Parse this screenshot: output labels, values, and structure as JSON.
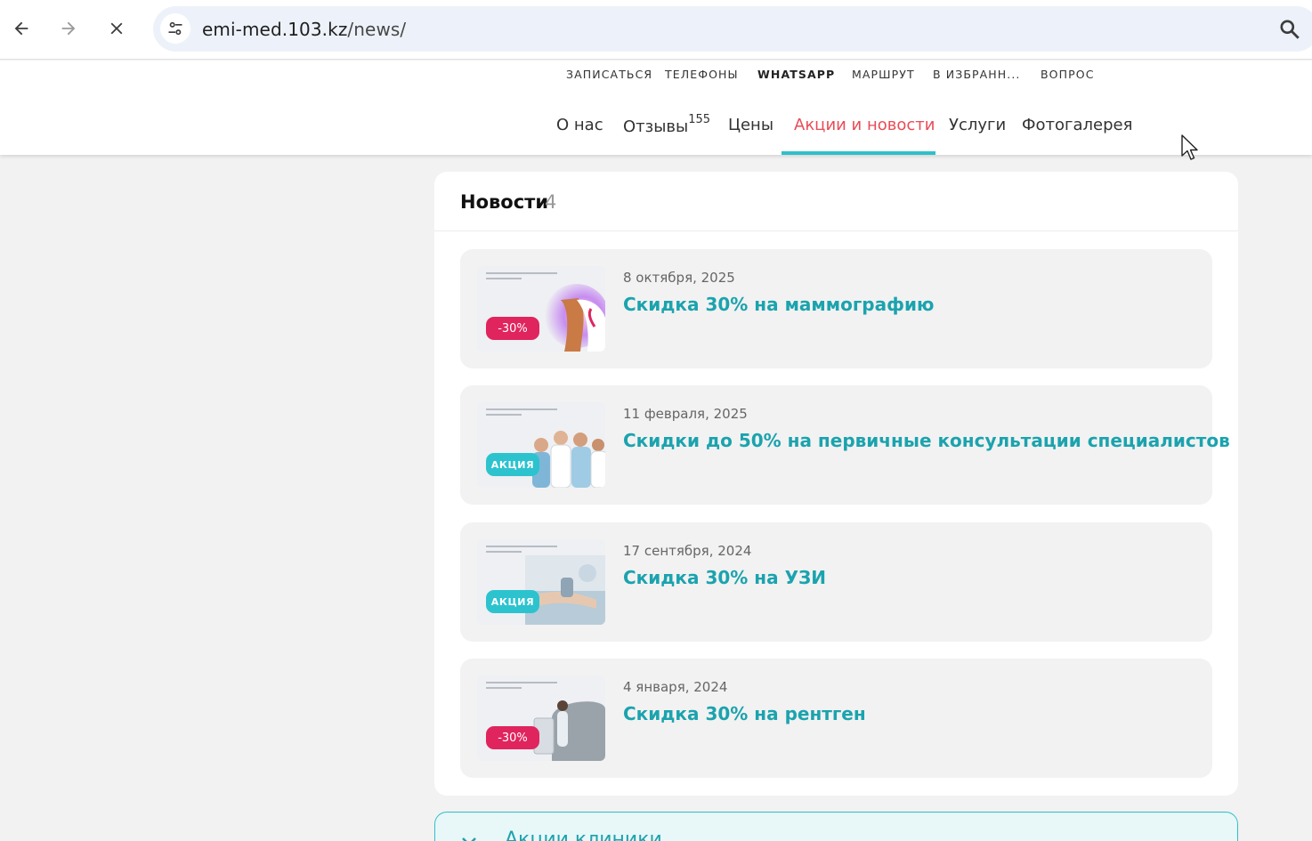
{
  "browser": {
    "url_host": "emi-med.103.kz",
    "url_path": "/news/",
    "back_icon": "arrow-left-icon",
    "forward_icon": "arrow-right-icon",
    "stop_icon": "close-icon",
    "site_info_icon": "tune-icon",
    "zoom_icon": "magnifier-icon"
  },
  "header": {
    "quick_links": [
      "ЗАПИСАТЬСЯ",
      "ТЕЛЕФОНЫ",
      "WHATSAPP",
      "МАРШРУТ",
      "В ИЗБРАНН...",
      "ВОПРОС"
    ],
    "tabs": [
      {
        "label": "О нас"
      },
      {
        "label": "Отзывы",
        "count": "155"
      },
      {
        "label": "Цены"
      },
      {
        "label": "Акции и новости"
      },
      {
        "label": "Услуги"
      },
      {
        "label": "Фотогалерея"
      }
    ],
    "active_color": "#e84c57",
    "underline_color": "#2fbfc9"
  },
  "news": {
    "title": "Новости",
    "count": "4",
    "items": [
      {
        "date": "8 октября, 2025",
        "title": "Скидка 30% на маммографию",
        "badge": "-30%"
      },
      {
        "date": "11 февраля, 2025",
        "title": "Скидки до 50% на первичные консультации специалистов",
        "badge": "АКЦИЯ"
      },
      {
        "date": "17 сентября, 2024",
        "title": "Скидка 30% на УЗИ",
        "badge": "АКЦИЯ"
      },
      {
        "date": "4 января, 2024",
        "title": "Скидка 30% на рентген",
        "badge": "-30%"
      }
    ],
    "link_color": "#1ba3ae"
  },
  "next_section": {
    "text": "Акции клиники"
  }
}
